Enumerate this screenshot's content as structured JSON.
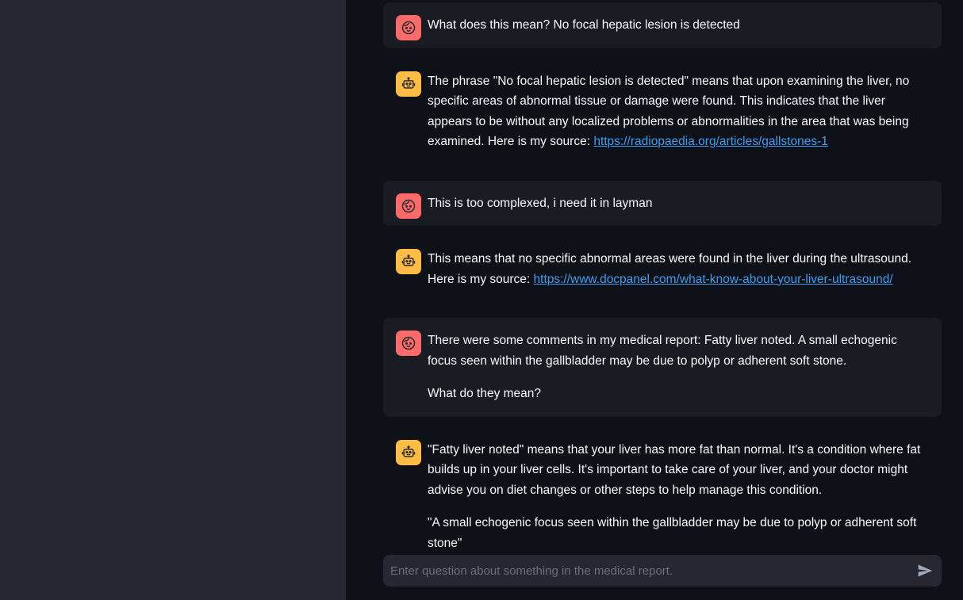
{
  "messages": [
    {
      "role": "user",
      "paragraphs": [
        "What does this mean? No focal hepatic lesion is detected"
      ]
    },
    {
      "role": "assistant",
      "text": "The phrase \"No focal hepatic lesion is detected\" means that upon examining the liver, no specific areas of abnormal tissue or damage were found. This indicates that the liver appears to be without any localized problems or abnormalities in the area that was being examined. Here is my source: ",
      "link": "https://radiopaedia.org/articles/gallstones-1"
    },
    {
      "role": "user",
      "paragraphs": [
        "This is too complexed, i need it in layman"
      ]
    },
    {
      "role": "assistant",
      "text": "This means that no specific abnormal areas were found in the liver during the ultrasound. Here is my source: ",
      "link": "https://www.docpanel.com/what-know-about-your-liver-ultrasound/"
    },
    {
      "role": "user",
      "paragraphs": [
        "There were some comments in my medical report: Fatty liver noted. A small echogenic focus seen within the gallbladder may be due to polyp or adherent soft stone.",
        "What do they mean?"
      ]
    },
    {
      "role": "assistant",
      "paragraphs": [
        "\"Fatty liver noted\" means that your liver has more fat than normal. It's a condition where fat builds up in your liver cells. It's important to take care of your liver, and your doctor might advise you on diet changes or other steps to help manage this condition.",
        "\"A small echogenic focus seen within the gallbladder may be due to polyp or adherent soft stone\""
      ]
    }
  ],
  "chat_input": {
    "placeholder": "Enter question about something in the medical report.",
    "value": ""
  },
  "icons": {
    "user_avatar": "face-icon",
    "assistant_avatar": "robot-icon",
    "send": "send-icon"
  },
  "colors": {
    "background": "#0e1117",
    "sidebar": "#262730",
    "user_bubble": "#1a1c24",
    "user_avatar": "#ff6b6b",
    "assistant_avatar": "#ffbd45",
    "link": "#3d9df3"
  }
}
